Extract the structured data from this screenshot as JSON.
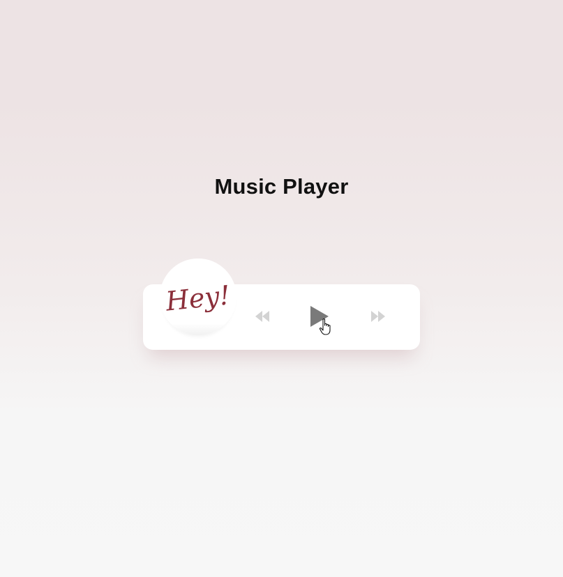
{
  "page": {
    "title": "Music Player"
  },
  "player": {
    "album_art_text": "Hey!",
    "controls": {
      "prev": {
        "icon": "rewind-icon",
        "label": "Previous"
      },
      "play": {
        "icon": "play-icon",
        "label": "Play"
      },
      "next": {
        "icon": "fast-forward-icon",
        "label": "Next"
      }
    }
  },
  "colors": {
    "album_text": "#8b2f3a",
    "play_icon": "#7a7a7a",
    "skip_icon": "#d3d3d3"
  }
}
